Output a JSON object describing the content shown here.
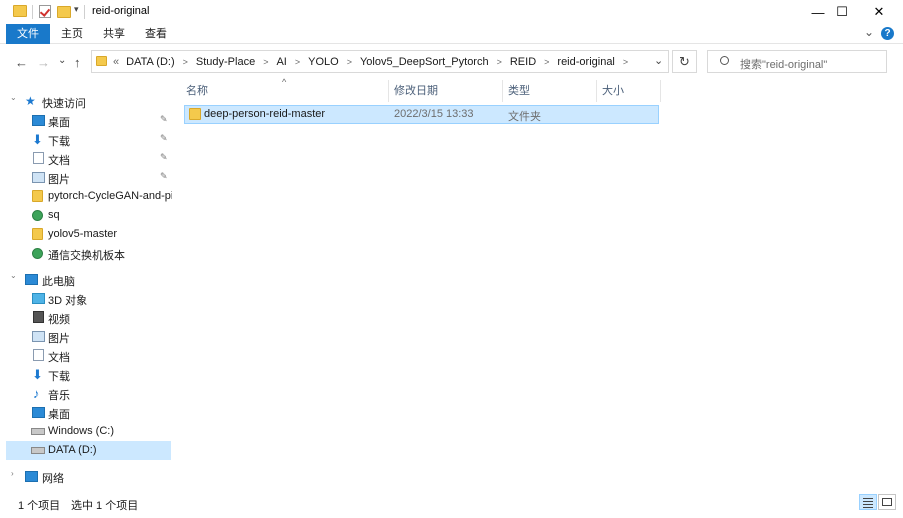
{
  "window": {
    "title": "reid-original",
    "minimize_glyph": "—",
    "maximize_glyph": "☐",
    "close_glyph": "✕",
    "help_glyph": "?"
  },
  "ribbon": {
    "tabs": [
      "文件",
      "主页",
      "共享",
      "查看"
    ],
    "expand_glyph": "⌄",
    "accent": "#1979ca"
  },
  "address": {
    "back": "←",
    "forward": "→",
    "recent": "⌄",
    "up": "↑",
    "overflow": "«",
    "crumbs": [
      "DATA (D:)",
      "Study-Place",
      "AI",
      "YOLO",
      "Yolov5_DeepSort_Pytorch",
      "REID",
      "reid-original"
    ],
    "dropdown": "⌄",
    "refresh": "↻"
  },
  "search": {
    "placeholder": "搜索\"reid-original\""
  },
  "nav": {
    "quick_access": "快速访问",
    "quick_items": [
      {
        "label": "桌面",
        "icon": "desktop-icon",
        "pinned": true
      },
      {
        "label": "下载",
        "icon": "download-icon",
        "pinned": true
      },
      {
        "label": "文档",
        "icon": "documents-icon",
        "pinned": true
      },
      {
        "label": "图片",
        "icon": "pictures-icon",
        "pinned": true
      },
      {
        "label": "pytorch-CycleGAN-and-pix",
        "icon": "folder-icon",
        "pinned": false
      },
      {
        "label": "sq",
        "icon": "synced-folder-icon",
        "pinned": false
      },
      {
        "label": "yolov5-master",
        "icon": "folder-icon",
        "pinned": false
      },
      {
        "label": "通信交换机板本",
        "icon": "synced-folder-icon",
        "pinned": false
      }
    ],
    "this_pc": "此电脑",
    "pc_items": [
      {
        "label": "3D 对象",
        "icon": "3d-objects-icon"
      },
      {
        "label": "视频",
        "icon": "videos-icon"
      },
      {
        "label": "图片",
        "icon": "pictures-icon"
      },
      {
        "label": "文档",
        "icon": "documents-icon"
      },
      {
        "label": "下载",
        "icon": "download-icon"
      },
      {
        "label": "音乐",
        "icon": "music-icon"
      },
      {
        "label": "桌面",
        "icon": "desktop-icon"
      },
      {
        "label": "Windows (C:)",
        "icon": "drive-icon"
      },
      {
        "label": "DATA (D:)",
        "icon": "drive-icon",
        "selected": true
      }
    ],
    "network": "网络"
  },
  "columns": {
    "name": "名称",
    "modified": "修改日期",
    "type": "类型",
    "size": "大小",
    "sort_glyph": "^"
  },
  "files": [
    {
      "name": "deep-person-reid-master",
      "modified": "2022/3/15 13:33",
      "type": "文件夹",
      "size": ""
    }
  ],
  "status": {
    "count": "1 个项目",
    "selected": "选中 1 个项目"
  }
}
